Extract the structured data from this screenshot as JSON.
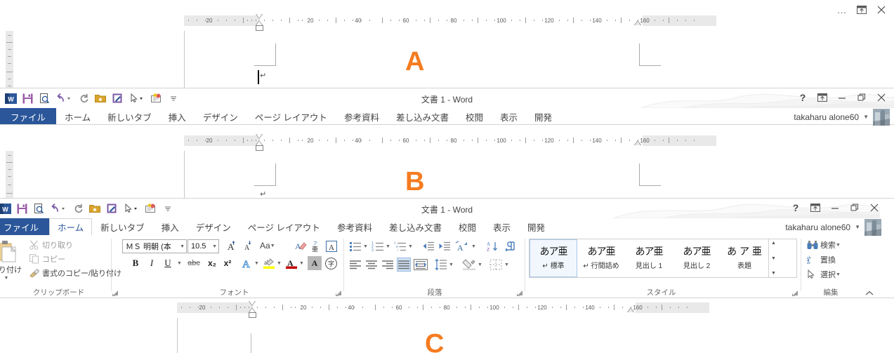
{
  "app": {
    "window_title": "文書 1 - Word",
    "user_name": "takaharu alone60"
  },
  "window_controls": {
    "help": "?",
    "ribbon_display_options": "ribbon-options-icon",
    "minimize": "—",
    "restore": "restore-icon",
    "close": "✕",
    "more": "…"
  },
  "quick_access": [
    {
      "name": "word-logo-icon",
      "label": "W"
    },
    {
      "name": "save-icon",
      "label": "保存"
    },
    {
      "name": "print-preview-icon",
      "label": "印刷プレビューと印刷"
    },
    {
      "name": "undo-icon",
      "label": "元に戻す"
    },
    {
      "name": "redo-icon",
      "label": "繰り返し"
    },
    {
      "name": "star-folder-icon",
      "label": "お気に入り"
    },
    {
      "name": "edit-document-icon",
      "label": "編集"
    },
    {
      "name": "pointer-icon",
      "label": "選択"
    },
    {
      "name": "new-comment-icon",
      "label": "コメント"
    },
    {
      "name": "customize-qat-icon",
      "label": "クイックアクセスツールバーのユーザー設定"
    }
  ],
  "tabs": [
    {
      "id": "file",
      "label": "ファイル"
    },
    {
      "id": "home",
      "label": "ホーム"
    },
    {
      "id": "newtab",
      "label": "新しいタブ"
    },
    {
      "id": "insert",
      "label": "挿入"
    },
    {
      "id": "design",
      "label": "デザイン"
    },
    {
      "id": "layout",
      "label": "ページ レイアウト"
    },
    {
      "id": "references",
      "label": "参考資料"
    },
    {
      "id": "mailings",
      "label": "差し込み文書"
    },
    {
      "id": "review",
      "label": "校閲"
    },
    {
      "id": "view",
      "label": "表示"
    },
    {
      "id": "developer",
      "label": "開発"
    }
  ],
  "active_tab": "ホーム",
  "ribbon": {
    "clipboard": {
      "group_label": "クリップボード",
      "paste_label": "貼り付け",
      "cut_label": "切り取り",
      "copy_label": "コピー",
      "format_painter_label": "書式のコピー/貼り付け"
    },
    "font": {
      "group_label": "フォント",
      "font_name": "ＭＳ 明朝 (本",
      "font_size": "10.5",
      "grow_font": "A",
      "shrink_font": "A",
      "change_case": "Aa",
      "clear_formatting": "書式のクリア",
      "phonetic_guide": "ルビ",
      "character_border": "A",
      "bold": "B",
      "italic": "I",
      "underline": "U",
      "strikethrough": "abc",
      "subscript": "x₂",
      "superscript": "x²",
      "text_effects": "A",
      "text_highlight": "ab",
      "font_color": "A",
      "character_shading": "A",
      "enclose_characters": "字"
    },
    "paragraph": {
      "group_label": "段落",
      "bullets": "箇条書き",
      "numbering": "段落番号",
      "multilevel": "アウトライン",
      "decrease_indent": "インデントを減らす",
      "increase_indent": "インデントを増やす",
      "asian_layout": "拡張書式",
      "sort": "並べ替え",
      "show_marks": "編集記号の表示/非表示",
      "align_left": "左揃え",
      "align_center": "中央揃え",
      "align_right": "右揃え",
      "justify": "両端揃え",
      "distribute": "均等割り付け",
      "line_spacing": "行と段落の間隔",
      "shading": "塗りつぶし",
      "borders": "罫線"
    },
    "styles": {
      "group_label": "スタイル",
      "items": [
        {
          "preview": "あア亜",
          "name": "標準",
          "mark": "↵",
          "selected": true
        },
        {
          "preview": "あア亜",
          "name": "行間詰め",
          "mark": "↵",
          "selected": false
        },
        {
          "preview": "あア亜",
          "name": "見出し 1",
          "mark": "",
          "selected": false
        },
        {
          "preview": "あア亜",
          "name": "見出し 2",
          "mark": "",
          "selected": false
        },
        {
          "preview": "あ ア 亜",
          "name": "表題",
          "mark": "",
          "selected": false
        }
      ]
    },
    "editing": {
      "group_label": "編集",
      "find_label": "検索",
      "replace_label": "置換",
      "select_label": "選択"
    }
  },
  "ruler": {
    "numbers_left": [
      "20"
    ],
    "numbers_right": [
      "20",
      "40",
      "60",
      "80",
      "100",
      "120",
      "140",
      "160"
    ],
    "unit": "mm"
  },
  "documents": [
    {
      "id": "A",
      "letter": "A",
      "has_caret": true,
      "has_pilcrow": true
    },
    {
      "id": "B",
      "letter": "B",
      "has_caret": false,
      "has_pilcrow": true
    },
    {
      "id": "C",
      "letter": "C",
      "has_caret": false,
      "has_pilcrow": false
    }
  ],
  "colors": {
    "accent_letter": "#f57c20",
    "file_tab_blue": "#2b579a",
    "active_tab_text": "#2b579a",
    "ruler_grey": "#e9e9e9",
    "window_border": "#d4d4d4"
  }
}
